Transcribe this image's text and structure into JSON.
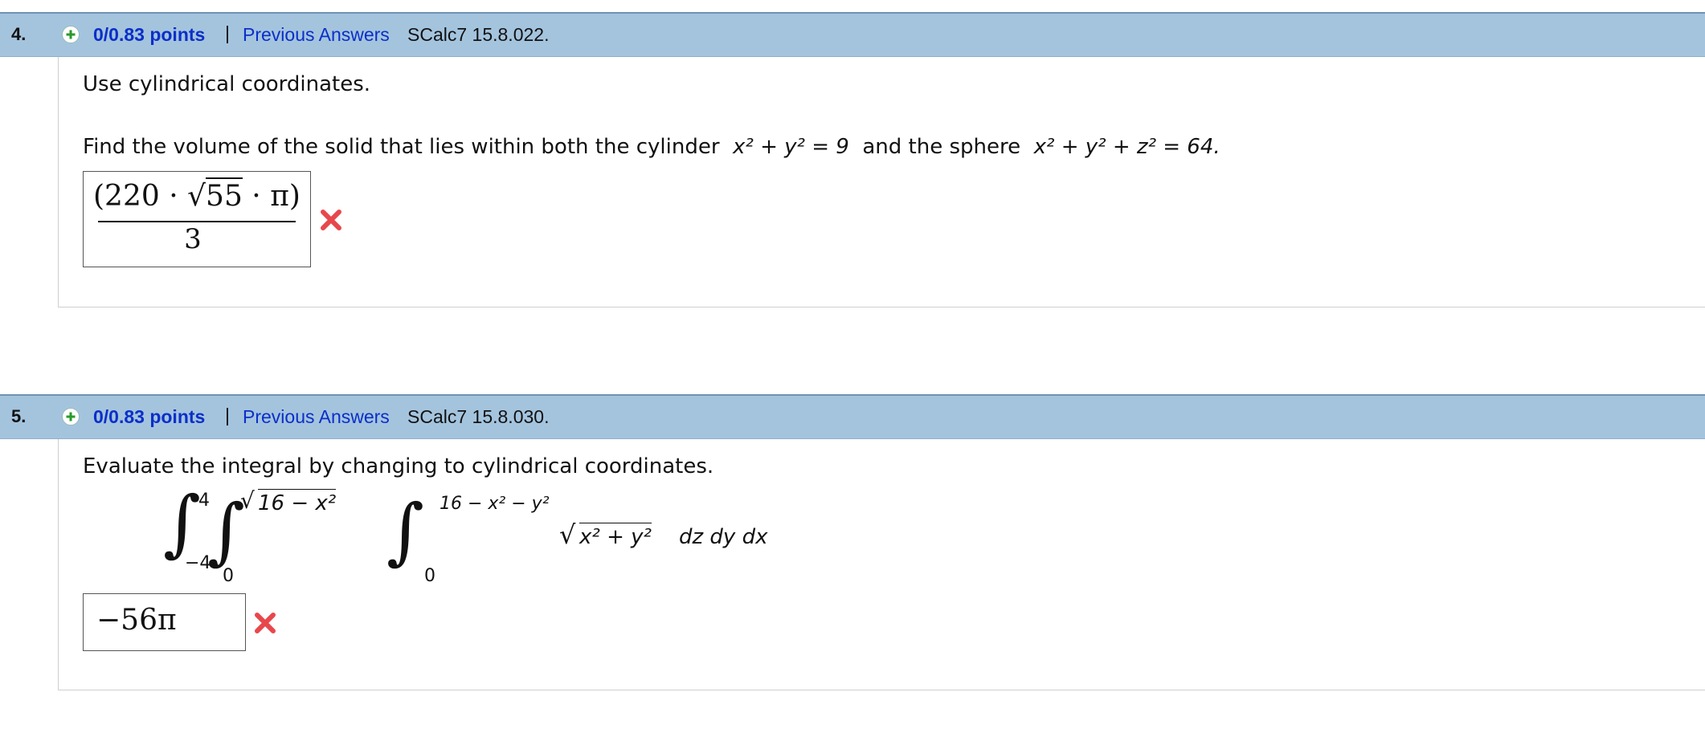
{
  "questions": [
    {
      "number": "4.",
      "points": "0/0.83 points",
      "separator": "|",
      "previous_answers": "Previous Answers",
      "code": "SCalc7 15.8.022.",
      "instruction": "Use cylindrical coordinates.",
      "prompt": {
        "lead": "Find the volume of the solid that lies within both the cylinder",
        "cylinder_eq": "x² + y² = 9",
        "mid": "and the sphere",
        "sphere_eq": "x² + y² + z² = 64."
      },
      "answer": {
        "numerator_left": "(220 · ",
        "radicand": "55",
        "numerator_right": " · π)",
        "denominator": "3"
      },
      "status_icon": "x-mark-icon"
    },
    {
      "number": "5.",
      "points": "0/0.83 points",
      "separator": "|",
      "previous_answers": "Previous Answers",
      "code": "SCalc7 15.8.030.",
      "instruction": "Evaluate the integral by changing to cylindrical coordinates.",
      "integral": {
        "outer_upper": "4",
        "outer_lower": "−4",
        "middle_upper": "16 − x²",
        "middle_lower": "0",
        "inner_upper": "16 − x² − y²",
        "inner_lower": "0",
        "integrand_radicand": "x² + y²",
        "differentials": "dz dy dx"
      },
      "answer": {
        "value": "−56π"
      },
      "status_icon": "x-mark-icon"
    }
  ],
  "colors": {
    "header_bg": "#a4c4de",
    "link": "#0b2fc9",
    "wrong": "#e8474c"
  }
}
